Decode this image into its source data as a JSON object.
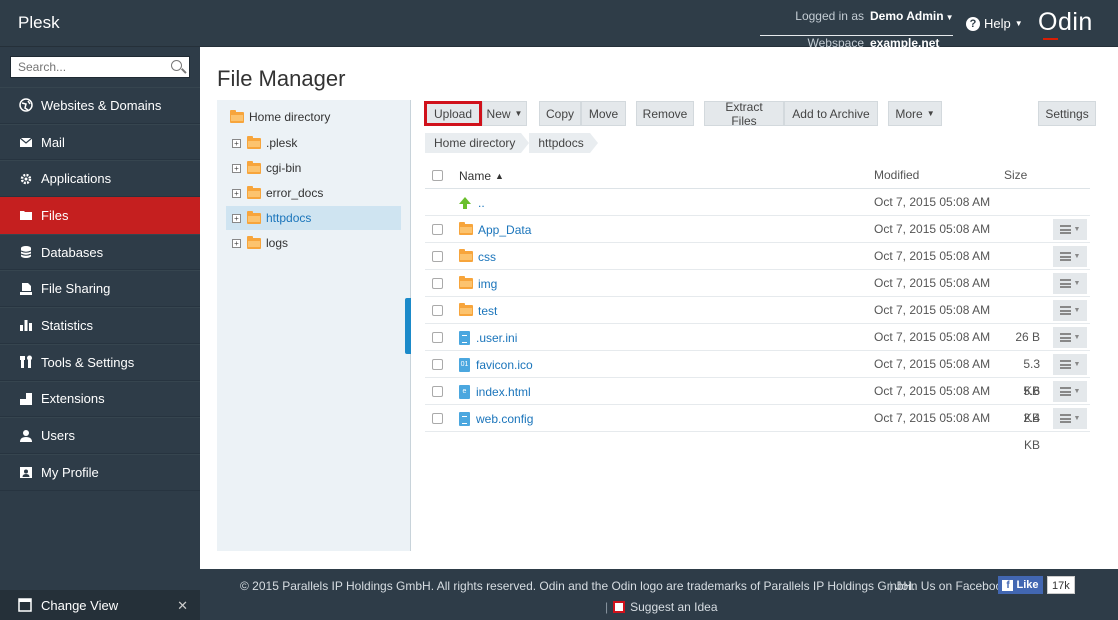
{
  "app": {
    "brand": "Plesk",
    "logo": "Odin"
  },
  "header": {
    "logged_in_label": "Logged in as",
    "user": "Demo Admin",
    "webspace_label": "Webspace",
    "webspace": "example.net",
    "help": "Help"
  },
  "sidebar": {
    "search_placeholder": "Search...",
    "items": [
      {
        "label": "Websites & Domains",
        "icon": "globe-icon"
      },
      {
        "label": "Mail",
        "icon": "mail-icon"
      },
      {
        "label": "Applications",
        "icon": "gear-icon"
      },
      {
        "label": "Files",
        "icon": "folder-icon",
        "active": true
      },
      {
        "label": "Databases",
        "icon": "database-icon"
      },
      {
        "label": "File Sharing",
        "icon": "file-sharing-icon"
      },
      {
        "label": "Statistics",
        "icon": "bar-chart-icon"
      },
      {
        "label": "Tools & Settings",
        "icon": "tools-icon"
      },
      {
        "label": "Extensions",
        "icon": "puzzle-icon"
      },
      {
        "label": "Users",
        "icon": "user-icon"
      },
      {
        "label": "My Profile",
        "icon": "profile-icon"
      }
    ],
    "change_view": "Change View"
  },
  "main": {
    "title": "File Manager",
    "tree": {
      "root": "Home directory",
      "items": [
        ".plesk",
        "cgi-bin",
        "error_docs",
        "httpdocs",
        "logs"
      ],
      "selected": "httpdocs"
    },
    "toolbar": {
      "upload": "Upload",
      "new": "New",
      "copy": "Copy",
      "move": "Move",
      "remove": "Remove",
      "extract": "Extract Files",
      "archive": "Add to Archive",
      "more": "More",
      "settings": "Settings"
    },
    "breadcrumb": [
      "Home directory",
      "httpdocs"
    ],
    "columns": {
      "name": "Name",
      "modified": "Modified",
      "size": "Size"
    },
    "rows": [
      {
        "name": "..",
        "modified": "Oct 7, 2015 05:08 AM",
        "size": "",
        "type": "up"
      },
      {
        "name": "App_Data",
        "modified": "Oct 7, 2015 05:08 AM",
        "size": "",
        "type": "folder"
      },
      {
        "name": "css",
        "modified": "Oct 7, 2015 05:08 AM",
        "size": "",
        "type": "folder"
      },
      {
        "name": "img",
        "modified": "Oct 7, 2015 05:08 AM",
        "size": "",
        "type": "folder"
      },
      {
        "name": "test",
        "modified": "Oct 7, 2015 05:08 AM",
        "size": "",
        "type": "folder"
      },
      {
        "name": ".user.ini",
        "modified": "Oct 7, 2015 05:08 AM",
        "size": "26 B",
        "type": "text"
      },
      {
        "name": "favicon.ico",
        "modified": "Oct 7, 2015 05:08 AM",
        "size": "5.3 KB",
        "type": "binary"
      },
      {
        "name": "index.html",
        "modified": "Oct 7, 2015 05:08 AM",
        "size": "5.6 KB",
        "type": "html"
      },
      {
        "name": "web.config",
        "modified": "Oct 7, 2015 05:08 AM",
        "size": "2.4 KB",
        "type": "text"
      }
    ]
  },
  "footer": {
    "copyright": "© 2015 Parallels IP Holdings GmbH. All rights reserved. Odin and the Odin logo are trademarks of Parallels IP Holdings GmbH.",
    "facebook": "Join Us on Facebook",
    "like": "Like",
    "like_count": "17k",
    "idea": "Suggest an Idea"
  },
  "colors": {
    "accent": "#c51f1f",
    "link": "#1b75bb",
    "sidebar": "#2e3c48",
    "upload_highlight": "#d0111b"
  }
}
